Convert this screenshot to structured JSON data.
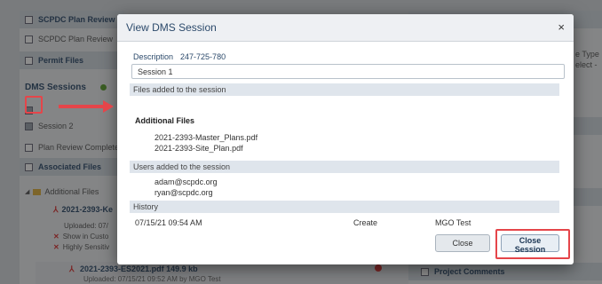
{
  "background": {
    "left_panel": {
      "rows": [
        {
          "label": "SCPDC Plan Review",
          "kind": "header"
        },
        {
          "label": "SCPDC Plan Review",
          "kind": "plain"
        },
        {
          "label": "Permit Files",
          "kind": "header"
        },
        {
          "label": "DMS Sessions",
          "kind": "section"
        },
        {
          "label": "Session 2",
          "kind": "plain"
        },
        {
          "label": "Plan Review Complete",
          "kind": "plain"
        },
        {
          "label": "Associated Files",
          "kind": "header"
        },
        {
          "label": "Additional Files",
          "kind": "plain"
        }
      ],
      "file_entry_1": "2021-2393-Ke",
      "file_entry_1_uploaded": "Uploaded: 07/",
      "file_entry_1_show": "Show in Custo",
      "file_entry_1_sensitive": "Highly Sensitiv",
      "file_entry_2": "2021-2393-ES2021.pdf",
      "file_entry_2_size": "149.9 kb",
      "file_entry_2_uploaded": "Uploaded: 07/15/21 09:52 AM by MGO Test"
    },
    "right_panel": {
      "type_label": "e Type",
      "select_label": "elect -",
      "project_comments": "Project Comments"
    }
  },
  "modal": {
    "title": "View DMS Session",
    "close_glyph": "×",
    "description_label": "Description",
    "session_id": "247-725-780",
    "description_value": "Session 1",
    "files_section_label": "Files added to the session",
    "additional_files_heading": "Additional Files",
    "files": [
      "2021-2393-Master_Plans.pdf",
      "2021-2393-Site_Plan.pdf"
    ],
    "users_section_label": "Users added to the session",
    "users": [
      "adam@scpdc.org",
      "ryan@scpdc.org"
    ],
    "history_label": "History",
    "history": [
      {
        "date": "07/15/21 09:54 AM",
        "action": "Create",
        "user": "MGO Test"
      }
    ],
    "buttons": {
      "close": "Close",
      "close_session": "Close Session"
    }
  },
  "colors": {
    "annotation_red": "#e5454a",
    "title_blue": "#2c4a6b",
    "section_bar": "#dfe5ec"
  }
}
